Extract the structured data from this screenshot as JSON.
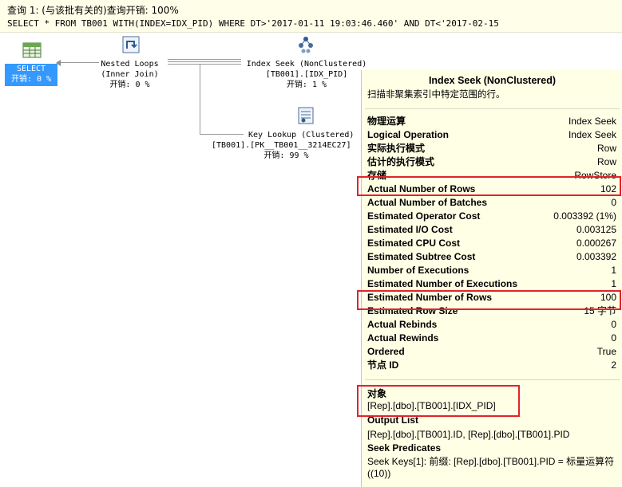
{
  "header": {
    "query_line": "查询 1: (与该批有关的)查询开销: 100%",
    "sql_line": "SELECT * FROM TB001 WITH(INDEX=IDX_PID) WHERE DT>'2017-01-11 19:03:46.460' AND DT<'2017-02-15"
  },
  "plan": {
    "select": {
      "name": "SELECT",
      "cost": "开销: 0 %"
    },
    "nested_loops": {
      "name": "Nested Loops",
      "sub": "(Inner Join)",
      "cost": "开销: 0 %"
    },
    "index_seek": {
      "name": "Index Seek (NonClustered)",
      "sub": "[TB001].[IDX_PID]",
      "cost": "开销: 1 %"
    },
    "key_lookup": {
      "name": "Key Lookup (Clustered)",
      "sub": "[TB001].[PK__TB001__3214EC27]",
      "cost": "开销: 99 %"
    }
  },
  "tooltip": {
    "title": "Index Seek (NonClustered)",
    "description": "扫描非聚集索引中特定范围的行。",
    "properties": [
      {
        "label": "物理运算",
        "value": "Index Seek"
      },
      {
        "label": "Logical Operation",
        "value": "Index Seek"
      },
      {
        "label": "实际执行模式",
        "value": "Row"
      },
      {
        "label": "估计的执行模式",
        "value": "Row"
      },
      {
        "label": "存储",
        "value": "RowStore"
      },
      {
        "label": "Actual Number of Rows",
        "value": "102"
      },
      {
        "label": "Actual Number of Batches",
        "value": "0"
      },
      {
        "label": "Estimated Operator Cost",
        "value": "0.003392 (1%)"
      },
      {
        "label": "Estimated I/O Cost",
        "value": "0.003125"
      },
      {
        "label": "Estimated CPU Cost",
        "value": "0.000267"
      },
      {
        "label": "Estimated Subtree Cost",
        "value": "0.003392"
      },
      {
        "label": "Number of Executions",
        "value": "1"
      },
      {
        "label": "Estimated Number of Executions",
        "value": "1"
      },
      {
        "label": "Estimated Number of Rows",
        "value": "100"
      },
      {
        "label": "Estimated Row Size",
        "value": "15 字节"
      },
      {
        "label": "Actual Rebinds",
        "value": "0"
      },
      {
        "label": "Actual Rewinds",
        "value": "0"
      },
      {
        "label": "Ordered",
        "value": "True"
      },
      {
        "label": "节点 ID",
        "value": "2"
      }
    ],
    "object_header": "对象",
    "object_value": "[Rep].[dbo].[TB001].[IDX_PID]",
    "output_header": "Output List",
    "output_value": "[Rep].[dbo].[TB001].ID, [Rep].[dbo].[TB001].PID",
    "seek_header": "Seek Predicates",
    "seek_value": "Seek Keys[1]: 前缀: [Rep].[dbo].[TB001].PID = 标量运算符((10))"
  },
  "colors": {
    "highlight": "#e0242b",
    "selected": "#3399ff",
    "tooltip_bg": "#ffffe5"
  }
}
